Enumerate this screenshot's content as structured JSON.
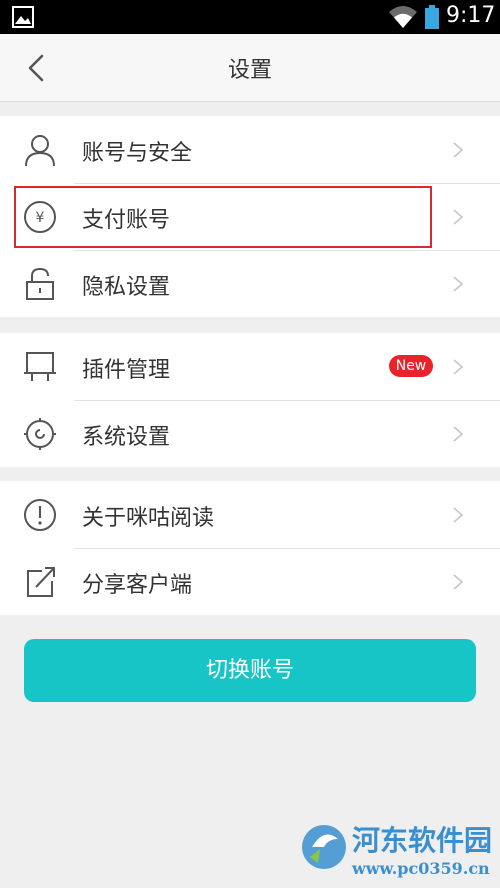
{
  "status_bar": {
    "time": "9:17"
  },
  "header": {
    "title": "设置"
  },
  "groups": [
    {
      "items": [
        {
          "label": "账号与安全",
          "icon": "user-icon"
        },
        {
          "label": "支付账号",
          "icon": "yen-icon"
        },
        {
          "label": "隐私设置",
          "icon": "lock-open-icon"
        }
      ]
    },
    {
      "items": [
        {
          "label": "插件管理",
          "icon": "plugin-icon",
          "badge": "New"
        },
        {
          "label": "系统设置",
          "icon": "gear-icon"
        }
      ]
    },
    {
      "items": [
        {
          "label": "关于咪咕阅读",
          "icon": "info-icon"
        },
        {
          "label": "分享客户端",
          "icon": "share-icon"
        }
      ]
    }
  ],
  "switch_button": {
    "label": "切换账号"
  },
  "watermark": {
    "name": "河东软件园",
    "url": "www.pc0359.cn"
  },
  "colors": {
    "accent": "#17c4c6",
    "badge": "#e8232a",
    "highlight": "#d62b33",
    "watermark": "#3a8fd0"
  }
}
